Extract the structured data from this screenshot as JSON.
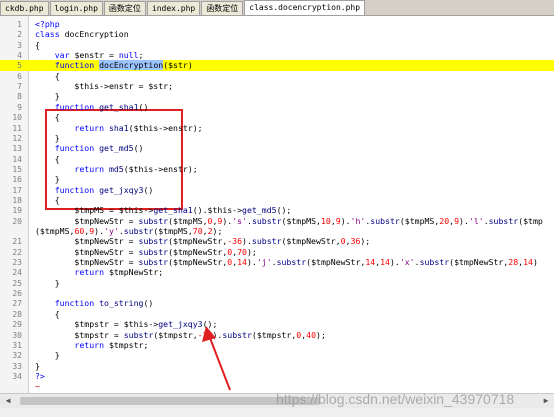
{
  "tabs": [
    {
      "label": "ckdb.php"
    },
    {
      "label": "login.php"
    },
    {
      "label": "函数定位"
    },
    {
      "label": "index.php"
    },
    {
      "label": "函数定位"
    },
    {
      "label": "class.docencryption.php"
    }
  ],
  "active_tab_index": 5,
  "lines": [
    {
      "num": "1",
      "tokens": [
        {
          "t": "<?php",
          "c": "k"
        }
      ]
    },
    {
      "num": "2",
      "tokens": [
        {
          "t": "class ",
          "c": "k"
        },
        {
          "t": "docEncryption",
          "c": "v"
        }
      ]
    },
    {
      "num": "3",
      "tokens": [
        {
          "t": "{",
          "c": "pun"
        }
      ]
    },
    {
      "num": "4",
      "tokens": [
        {
          "t": "    var ",
          "c": "k"
        },
        {
          "t": "$enstr",
          "c": "v"
        },
        {
          "t": " = ",
          "c": "pun"
        },
        {
          "t": "null",
          "c": "k"
        },
        {
          "t": ";",
          "c": "pun"
        }
      ]
    },
    {
      "num": "5",
      "hl": true,
      "tokens": [
        {
          "t": "    function ",
          "c": "k"
        },
        {
          "t": "docEncryption",
          "c": "sel"
        },
        {
          "t": "($str)",
          "c": "v"
        }
      ]
    },
    {
      "num": "6",
      "tokens": [
        {
          "t": "    {",
          "c": "pun"
        }
      ]
    },
    {
      "num": "7",
      "tokens": [
        {
          "t": "        $this->enstr = $str;",
          "c": "v"
        }
      ]
    },
    {
      "num": "8",
      "tokens": [
        {
          "t": "    }",
          "c": "pun"
        }
      ]
    },
    {
      "num": "9",
      "tokens": [
        {
          "t": "    function ",
          "c": "k"
        },
        {
          "t": "get_sha1",
          "c": "fn"
        },
        {
          "t": "()",
          "c": "pun"
        }
      ]
    },
    {
      "num": "10",
      "tokens": [
        {
          "t": "    {",
          "c": "pun"
        }
      ]
    },
    {
      "num": "11",
      "tokens": [
        {
          "t": "        return ",
          "c": "k"
        },
        {
          "t": "sha1",
          "c": "fn"
        },
        {
          "t": "($this->enstr);",
          "c": "v"
        }
      ]
    },
    {
      "num": "12",
      "tokens": [
        {
          "t": "    }",
          "c": "pun"
        }
      ]
    },
    {
      "num": "13",
      "tokens": [
        {
          "t": "    function ",
          "c": "k"
        },
        {
          "t": "get_md5",
          "c": "fn"
        },
        {
          "t": "()",
          "c": "pun"
        }
      ]
    },
    {
      "num": "14",
      "tokens": [
        {
          "t": "    {",
          "c": "pun"
        }
      ]
    },
    {
      "num": "15",
      "tokens": [
        {
          "t": "        return ",
          "c": "k"
        },
        {
          "t": "md5",
          "c": "fn"
        },
        {
          "t": "($this->enstr);",
          "c": "v"
        }
      ]
    },
    {
      "num": "16",
      "tokens": [
        {
          "t": "    }",
          "c": "pun"
        }
      ]
    },
    {
      "num": "17",
      "tokens": [
        {
          "t": "    function ",
          "c": "k"
        },
        {
          "t": "get_jxqy3",
          "c": "fn"
        },
        {
          "t": "()",
          "c": "pun"
        }
      ]
    },
    {
      "num": "18",
      "tokens": [
        {
          "t": "    {",
          "c": "pun"
        }
      ]
    },
    {
      "num": "19",
      "tokens": [
        {
          "t": "        $tmpMS = $this->",
          "c": "v"
        },
        {
          "t": "get_sha1",
          "c": "fn"
        },
        {
          "t": "().$this->",
          "c": "v"
        },
        {
          "t": "get_md5",
          "c": "fn"
        },
        {
          "t": "();",
          "c": "pun"
        }
      ]
    },
    {
      "num": "20",
      "tokens": [
        {
          "t": "        $tmpNewStr = ",
          "c": "v"
        },
        {
          "t": "substr",
          "c": "fn"
        },
        {
          "t": "($tmpMS,",
          "c": "v"
        },
        {
          "t": "0",
          "c": "n"
        },
        {
          "t": ",",
          "c": "pun"
        },
        {
          "t": "9",
          "c": "n"
        },
        {
          "t": ").",
          "c": "pun"
        },
        {
          "t": "'s'",
          "c": "s"
        },
        {
          "t": ".",
          "c": "pun"
        },
        {
          "t": "substr",
          "c": "fn"
        },
        {
          "t": "($tmpMS,",
          "c": "v"
        },
        {
          "t": "10",
          "c": "n"
        },
        {
          "t": ",",
          "c": "pun"
        },
        {
          "t": "9",
          "c": "n"
        },
        {
          "t": ").",
          "c": "pun"
        },
        {
          "t": "'h'",
          "c": "s"
        },
        {
          "t": ".",
          "c": "pun"
        },
        {
          "t": "substr",
          "c": "fn"
        },
        {
          "t": "($tmpMS,",
          "c": "v"
        },
        {
          "t": "20",
          "c": "n"
        },
        {
          "t": ",",
          "c": "pun"
        },
        {
          "t": "9",
          "c": "n"
        },
        {
          "t": ").",
          "c": "pun"
        },
        {
          "t": "'l'",
          "c": "s"
        },
        {
          "t": ".",
          "c": "pun"
        },
        {
          "t": "substr",
          "c": "fn"
        },
        {
          "t": "($tmp",
          "c": "v"
        }
      ]
    },
    {
      "num": "",
      "tokens": [
        {
          "t": "($tmpMS,",
          "c": "v"
        },
        {
          "t": "60",
          "c": "n"
        },
        {
          "t": ",",
          "c": "pun"
        },
        {
          "t": "9",
          "c": "n"
        },
        {
          "t": ").",
          "c": "pun"
        },
        {
          "t": "'y'",
          "c": "s"
        },
        {
          "t": ".",
          "c": "pun"
        },
        {
          "t": "substr",
          "c": "fn"
        },
        {
          "t": "($tmpMS,",
          "c": "v"
        },
        {
          "t": "70",
          "c": "n"
        },
        {
          "t": ",",
          "c": "pun"
        },
        {
          "t": "2",
          "c": "n"
        },
        {
          "t": ");",
          "c": "pun"
        }
      ]
    },
    {
      "num": "21",
      "tokens": [
        {
          "t": "        $tmpNewStr = ",
          "c": "v"
        },
        {
          "t": "substr",
          "c": "fn"
        },
        {
          "t": "($tmpNewStr,",
          "c": "v"
        },
        {
          "t": "-36",
          "c": "n"
        },
        {
          "t": ").",
          "c": "pun"
        },
        {
          "t": "substr",
          "c": "fn"
        },
        {
          "t": "($tmpNewStr,",
          "c": "v"
        },
        {
          "t": "0",
          "c": "n"
        },
        {
          "t": ",",
          "c": "pun"
        },
        {
          "t": "36",
          "c": "n"
        },
        {
          "t": ");",
          "c": "pun"
        }
      ]
    },
    {
      "num": "22",
      "tokens": [
        {
          "t": "        $tmpNewStr = ",
          "c": "v"
        },
        {
          "t": "substr",
          "c": "fn"
        },
        {
          "t": "($tmpNewStr,",
          "c": "v"
        },
        {
          "t": "0",
          "c": "n"
        },
        {
          "t": ",",
          "c": "pun"
        },
        {
          "t": "70",
          "c": "n"
        },
        {
          "t": ");",
          "c": "pun"
        }
      ]
    },
    {
      "num": "23",
      "tokens": [
        {
          "t": "        $tmpNewStr = ",
          "c": "v"
        },
        {
          "t": "substr",
          "c": "fn"
        },
        {
          "t": "($tmpNewStr,",
          "c": "v"
        },
        {
          "t": "0",
          "c": "n"
        },
        {
          "t": ",",
          "c": "pun"
        },
        {
          "t": "14",
          "c": "n"
        },
        {
          "t": ").",
          "c": "pun"
        },
        {
          "t": "'j'",
          "c": "s"
        },
        {
          "t": ".",
          "c": "pun"
        },
        {
          "t": "substr",
          "c": "fn"
        },
        {
          "t": "($tmpNewStr,",
          "c": "v"
        },
        {
          "t": "14",
          "c": "n"
        },
        {
          "t": ",",
          "c": "pun"
        },
        {
          "t": "14",
          "c": "n"
        },
        {
          "t": ").",
          "c": "pun"
        },
        {
          "t": "'x'",
          "c": "s"
        },
        {
          "t": ".",
          "c": "pun"
        },
        {
          "t": "substr",
          "c": "fn"
        },
        {
          "t": "($tmpNewStr,",
          "c": "v"
        },
        {
          "t": "28",
          "c": "n"
        },
        {
          "t": ",",
          "c": "pun"
        },
        {
          "t": "14",
          "c": "n"
        },
        {
          "t": ")",
          "c": "pun"
        }
      ]
    },
    {
      "num": "24",
      "tokens": [
        {
          "t": "        return ",
          "c": "k"
        },
        {
          "t": "$tmpNewStr;",
          "c": "v"
        }
      ]
    },
    {
      "num": "25",
      "tokens": [
        {
          "t": "    }",
          "c": "pun"
        }
      ]
    },
    {
      "num": "26",
      "tokens": [
        {
          "t": "",
          "c": "pun"
        }
      ]
    },
    {
      "num": "27",
      "tokens": [
        {
          "t": "    function ",
          "c": "k"
        },
        {
          "t": "to_string",
          "c": "fn"
        },
        {
          "t": "()",
          "c": "pun"
        }
      ]
    },
    {
      "num": "28",
      "tokens": [
        {
          "t": "    {",
          "c": "pun"
        }
      ]
    },
    {
      "num": "29",
      "tokens": [
        {
          "t": "        $tmpstr = $this->",
          "c": "v"
        },
        {
          "t": "get_jxqy3",
          "c": "fn"
        },
        {
          "t": "();",
          "c": "pun"
        }
      ]
    },
    {
      "num": "30",
      "tokens": [
        {
          "t": "        $tmpstr = ",
          "c": "v"
        },
        {
          "t": "substr",
          "c": "fn"
        },
        {
          "t": "($tmpstr,",
          "c": "v"
        },
        {
          "t": "-35",
          "c": "n"
        },
        {
          "t": ").",
          "c": "pun"
        },
        {
          "t": "substr",
          "c": "fn"
        },
        {
          "t": "($tmpstr,",
          "c": "v"
        },
        {
          "t": "0",
          "c": "n"
        },
        {
          "t": ",",
          "c": "pun"
        },
        {
          "t": "40",
          "c": "n"
        },
        {
          "t": ");",
          "c": "pun"
        }
      ]
    },
    {
      "num": "31",
      "tokens": [
        {
          "t": "        return ",
          "c": "k"
        },
        {
          "t": "$tmpstr;",
          "c": "v"
        }
      ]
    },
    {
      "num": "32",
      "tokens": [
        {
          "t": "    }",
          "c": "pun"
        }
      ]
    },
    {
      "num": "33",
      "tokens": [
        {
          "t": "}",
          "c": "pun"
        }
      ]
    },
    {
      "num": "34",
      "tokens": [
        {
          "t": "?>",
          "c": "k"
        }
      ]
    },
    {
      "num": "",
      "tokens": [
        {
          "t": "~",
          "c": "tilde"
        }
      ]
    },
    {
      "num": "",
      "tokens": [
        {
          "t": "~",
          "c": "tilde"
        }
      ]
    },
    {
      "num": "",
      "tokens": [
        {
          "t": "~",
          "c": "tilde"
        }
      ]
    },
    {
      "num": "",
      "tokens": [
        {
          "t": "~",
          "c": "tilde"
        }
      ]
    }
  ],
  "watermark": "https://blog.csdn.net/weixin_43970718",
  "colors": {
    "highlight_line": "#ffff00",
    "annotation": "#e02020"
  }
}
